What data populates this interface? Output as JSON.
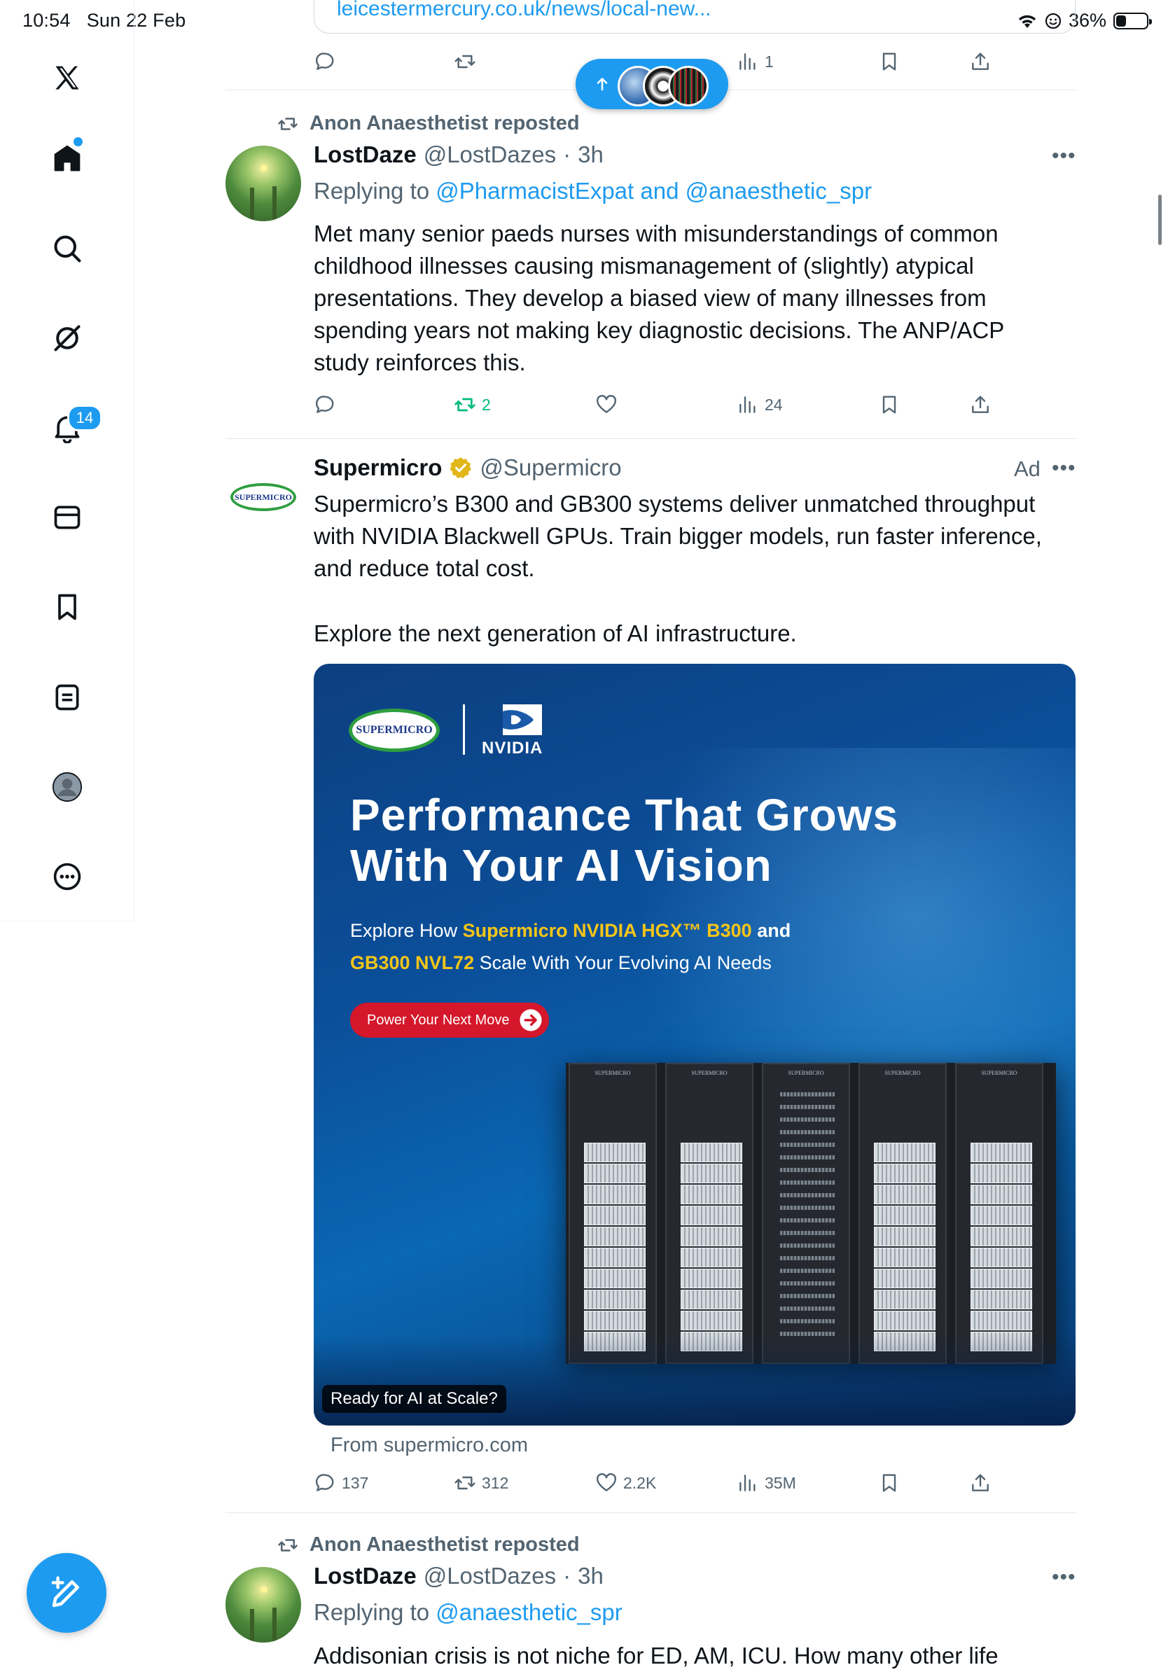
{
  "status_bar": {
    "time": "10:54",
    "date": "Sun 22 Feb",
    "battery": "36%"
  },
  "sidebar": {
    "logo": "x-logo-icon",
    "items": [
      {
        "name": "home-icon"
      },
      {
        "name": "search-icon"
      },
      {
        "name": "grok-icon"
      },
      {
        "name": "notifications-icon",
        "badge": "14"
      },
      {
        "name": "messages-icon"
      },
      {
        "name": "bookmarks-icon"
      },
      {
        "name": "lists-icon"
      },
      {
        "name": "profile-icon"
      },
      {
        "name": "more-icon"
      }
    ]
  },
  "top_tweet": {
    "link_fragment": "leicestermercury.co.uk/news/local-new...",
    "views": "1"
  },
  "new_posts_pill": {
    "icon": "arrow-up-icon"
  },
  "tweet1": {
    "repost_by": "Anon Anaesthetist reposted",
    "name": "LostDaze",
    "handle": "@LostDazes",
    "time": "3h",
    "reply_prefix": "Replying to ",
    "reply_to": "@PharmacistExpat and @anaesthetic_spr",
    "text": "Met many senior paeds nurses with misunderstandings of common childhood illnesses causing mismanagement of (slightly) atypical presentations. They develop a biased view of many illnesses from spending years not making key diagnostic decisions. The ANP/ACP study reinforces this.",
    "retweets": "2",
    "views": "24"
  },
  "ad_tweet": {
    "name": "Supermicro",
    "handle": "@Supermicro",
    "ad_label": "Ad",
    "text1": "Supermicro’s B300 and GB300 systems deliver unmatched throughput with NVIDIA Blackwell GPUs. Train bigger models, run faster inference, and reduce total cost.",
    "text2": "Explore the next generation of AI infrastructure.",
    "card": {
      "logo_supermicro": "SUPERMICRO",
      "logo_nvidia": "NVIDIA",
      "headline1": "Performance That Grows",
      "headline2": "With Your AI Vision",
      "sub_pre": "Explore How ",
      "sub_hl1": "Supermicro NVIDIA HGX™ B300",
      "sub_mid": " and",
      "sub_hl2": "GB300 NVL72",
      "sub_post": " Scale With Your Evolving AI Needs",
      "cta": "Power Your Next Move",
      "caption": "Ready for AI at Scale?",
      "rack_label": "SUPERMICRO"
    },
    "source": "From supermicro.com",
    "replies": "137",
    "retweets": "312",
    "likes": "2.2K",
    "views": "35M"
  },
  "tweet2": {
    "repost_by": "Anon Anaesthetist reposted",
    "name": "LostDaze",
    "handle": "@LostDazes",
    "time": "3h",
    "reply_prefix": "Replying to ",
    "reply_to": "@anaesthetic_spr",
    "text": "Addisonian crisis is not niche for ED, AM, ICU. How many other life"
  },
  "colors": {
    "accent": "#1d9bf0",
    "retweet_green": "#00ba7c",
    "muted": "#536471",
    "verified_gold": "#e2b719"
  }
}
